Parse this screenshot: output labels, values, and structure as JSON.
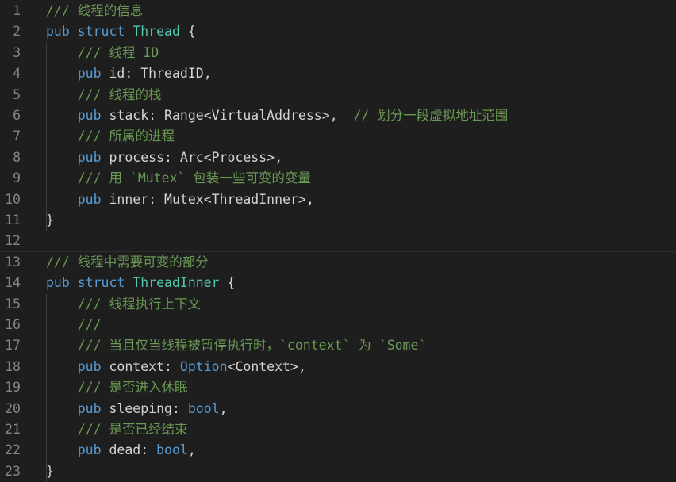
{
  "editor": {
    "lines": [
      {
        "n": "1",
        "tokens": [
          {
            "t": "/// 线程的信息",
            "c": "cm"
          }
        ]
      },
      {
        "n": "2",
        "tokens": [
          {
            "t": "pub struct ",
            "c": "kw"
          },
          {
            "t": "Thread",
            "c": "ty"
          },
          {
            "t": " {",
            "c": "pn"
          }
        ]
      },
      {
        "n": "3",
        "tokens": [
          {
            "t": "    "
          },
          {
            "t": "/// 线程 ID",
            "c": "cm"
          }
        ]
      },
      {
        "n": "4",
        "tokens": [
          {
            "t": "    "
          },
          {
            "t": "pub",
            "c": "kw"
          },
          {
            "t": " id: ThreadID,",
            "c": "fd"
          }
        ]
      },
      {
        "n": "5",
        "tokens": [
          {
            "t": "    "
          },
          {
            "t": "/// 线程的栈",
            "c": "cm"
          }
        ]
      },
      {
        "n": "6",
        "tokens": [
          {
            "t": "    "
          },
          {
            "t": "pub",
            "c": "kw"
          },
          {
            "t": " stack: Range<VirtualAddress>,  ",
            "c": "fd"
          },
          {
            "t": "// 划分一段虚拟地址范围",
            "c": "cm"
          }
        ]
      },
      {
        "n": "7",
        "tokens": [
          {
            "t": "    "
          },
          {
            "t": "/// 所属的进程",
            "c": "cm"
          }
        ]
      },
      {
        "n": "8",
        "tokens": [
          {
            "t": "    "
          },
          {
            "t": "pub",
            "c": "kw"
          },
          {
            "t": " process: Arc<Process>,",
            "c": "fd"
          }
        ]
      },
      {
        "n": "9",
        "tokens": [
          {
            "t": "    "
          },
          {
            "t": "/// 用 `Mutex` 包装一些可变的变量",
            "c": "cm"
          }
        ]
      },
      {
        "n": "10",
        "tokens": [
          {
            "t": "    "
          },
          {
            "t": "pub",
            "c": "kw"
          },
          {
            "t": " inner: Mutex<ThreadInner>,",
            "c": "fd"
          }
        ]
      },
      {
        "n": "11",
        "tokens": [
          {
            "t": "}",
            "c": "pn"
          }
        ]
      },
      {
        "n": "12",
        "tokens": [],
        "current": true
      },
      {
        "n": "13",
        "tokens": [
          {
            "t": "/// 线程中需要可变的部分",
            "c": "cm"
          }
        ]
      },
      {
        "n": "14",
        "tokens": [
          {
            "t": "pub struct ",
            "c": "kw"
          },
          {
            "t": "ThreadInner",
            "c": "ty"
          },
          {
            "t": " {",
            "c": "pn"
          }
        ]
      },
      {
        "n": "15",
        "tokens": [
          {
            "t": "    "
          },
          {
            "t": "/// 线程执行上下文",
            "c": "cm"
          }
        ]
      },
      {
        "n": "16",
        "tokens": [
          {
            "t": "    "
          },
          {
            "t": "///",
            "c": "cm"
          }
        ]
      },
      {
        "n": "17",
        "tokens": [
          {
            "t": "    "
          },
          {
            "t": "/// 当且仅当线程被暂停执行时，`context` 为 `Some`",
            "c": "cm"
          }
        ]
      },
      {
        "n": "18",
        "tokens": [
          {
            "t": "    "
          },
          {
            "t": "pub",
            "c": "kw"
          },
          {
            "t": " context: ",
            "c": "fd"
          },
          {
            "t": "Option",
            "c": "kw"
          },
          {
            "t": "<Context>,",
            "c": "fd"
          }
        ]
      },
      {
        "n": "19",
        "tokens": [
          {
            "t": "    "
          },
          {
            "t": "/// 是否进入休眠",
            "c": "cm"
          }
        ]
      },
      {
        "n": "20",
        "tokens": [
          {
            "t": "    "
          },
          {
            "t": "pub",
            "c": "kw"
          },
          {
            "t": " sleeping: ",
            "c": "fd"
          },
          {
            "t": "bool",
            "c": "kw"
          },
          {
            "t": ",",
            "c": "fd"
          }
        ]
      },
      {
        "n": "21",
        "tokens": [
          {
            "t": "    "
          },
          {
            "t": "/// 是否已经结束",
            "c": "cm"
          }
        ]
      },
      {
        "n": "22",
        "tokens": [
          {
            "t": "    "
          },
          {
            "t": "pub",
            "c": "kw"
          },
          {
            "t": " dead: ",
            "c": "fd"
          },
          {
            "t": "bool",
            "c": "kw"
          },
          {
            "t": ",",
            "c": "fd"
          }
        ]
      },
      {
        "n": "23",
        "tokens": [
          {
            "t": "}",
            "c": "pn"
          }
        ]
      }
    ],
    "colors": {
      "background": "#1e1e1e",
      "line_number": "#858585",
      "keyword": "#569cd6",
      "type": "#4ec9b0",
      "comment": "#6a9955",
      "text": "#d4d4d4"
    }
  }
}
